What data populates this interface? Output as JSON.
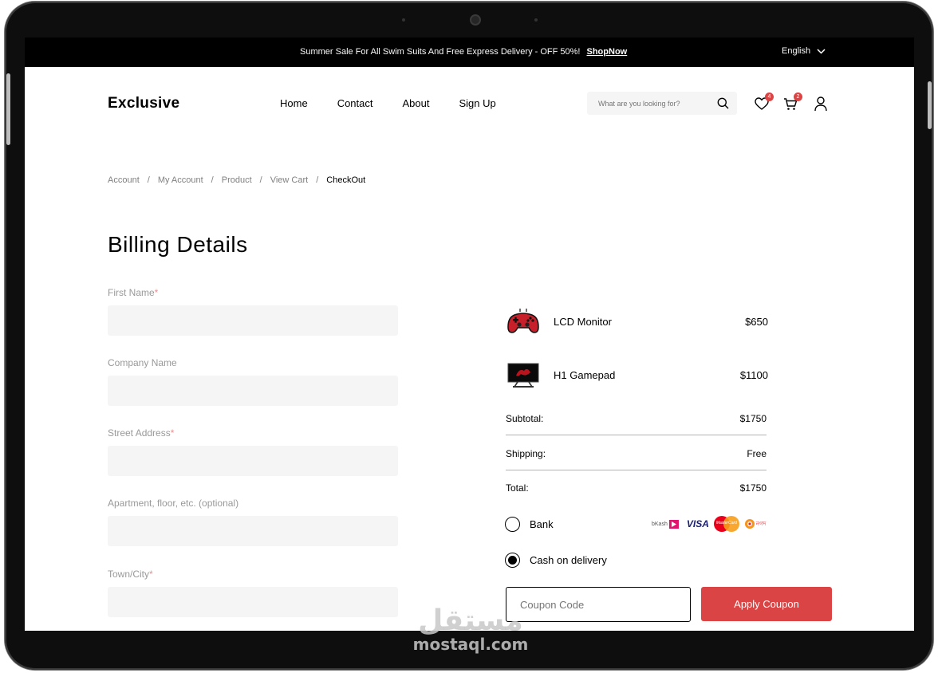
{
  "topbar": {
    "promo": "Summer Sale For All Swim Suits And Free Express Delivery - OFF 50%!",
    "shop_now": "ShopNow",
    "language": "English"
  },
  "header": {
    "logo": "Exclusive",
    "nav": [
      "Home",
      "Contact",
      "About",
      "Sign Up"
    ],
    "search_placeholder": "What are you looking for?",
    "wishlist_count": "4",
    "cart_count": "2"
  },
  "breadcrumb": [
    "Account",
    "My Account",
    "Product",
    "View Cart",
    "CheckOut"
  ],
  "page_title": "Billing Details",
  "form": {
    "fields": [
      {
        "label": "First Name",
        "required": "*"
      },
      {
        "label": "Company Name",
        "required": ""
      },
      {
        "label": "Street Address",
        "required": "*"
      },
      {
        "label": "Apartment, floor, etc. (optional)",
        "required": ""
      },
      {
        "label": "Town/City",
        "required": "*"
      }
    ]
  },
  "order": {
    "items": [
      {
        "name": "LCD Monitor",
        "price": "$650"
      },
      {
        "name": "H1 Gamepad",
        "price": "$1100"
      }
    ],
    "subtotal_label": "Subtotal:",
    "subtotal": "$1750",
    "shipping_label": "Shipping:",
    "shipping": "Free",
    "total_label": "Total:",
    "total": "$1750"
  },
  "payment": {
    "bank_label": "Bank",
    "cod_label": "Cash on delivery",
    "selected": "cod",
    "card_logos": {
      "bkash": "bKash",
      "visa": "VISA",
      "mastercard": "MasterCard",
      "nagad": "নগদ"
    }
  },
  "coupon": {
    "placeholder": "Coupon Code",
    "apply_label": "Apply Coupon"
  },
  "watermark": {
    "arabic": "مستقل",
    "latin": "mostaql.com"
  },
  "colors": {
    "accent": "#DB4444",
    "input_bg": "#F5F5F5",
    "topbar_bg": "#000000"
  }
}
